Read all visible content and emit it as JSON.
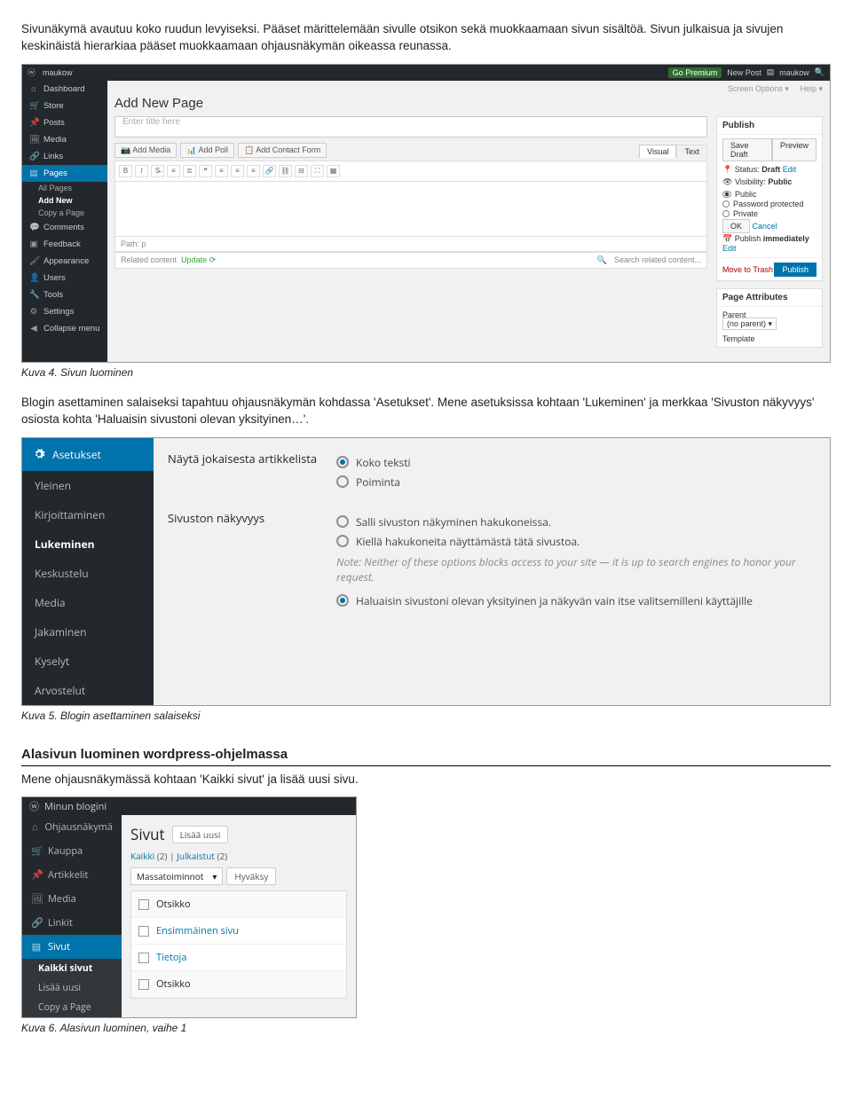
{
  "intro": {
    "p1": "Sivunäkymä avautuu koko ruudun levyiseksi. Pääset märittelemään sivulle otsikon sekä muokkaamaan sivun sisältöä. Sivun julkaisua ja sivujen keskinäistä hierarkiaa pääset muokkaamaan ohjausnäkymän oikeassa reunassa."
  },
  "s1": {
    "adminbar_site": "maukow",
    "adminbar_premium": "Go Premium",
    "adminbar_newpost": "New Post",
    "adminbar_user": "maukow",
    "screen_options": "Screen Options ▾",
    "help_tab": "Help ▾",
    "menu": [
      "Dashboard",
      "Store",
      "Posts",
      "Media",
      "Links",
      "Pages",
      "Comments",
      "Feedback",
      "Appearance",
      "Users",
      "Tools",
      "Settings",
      "Collapse menu"
    ],
    "pages_sub": [
      "All Pages",
      "Add New",
      "Copy a Page"
    ],
    "h1": "Add New Page",
    "placeholder": "Enter title here",
    "add_media": "Add Media",
    "add_poll": "Add Poll",
    "add_contact": "Add Contact Form",
    "visual": "Visual",
    "text": "Text",
    "path_label": "Path:",
    "path_val": "p",
    "related_label": "Related content",
    "update": "Update",
    "search_related": "Search related content...",
    "publish": {
      "title": "Publish",
      "save_draft": "Save Draft",
      "preview": "Preview",
      "status_lbl": "Status:",
      "status_val": "Draft",
      "edit": "Edit",
      "visibility_lbl": "Visibility:",
      "visibility_val": "Public",
      "v_public": "Public",
      "v_pw": "Password protected",
      "v_priv": "Private",
      "ok": "OK",
      "cancel": "Cancel",
      "sched_lbl": "Publish",
      "sched_val": "immediately",
      "trash": "Move to Trash",
      "publish_btn": "Publish"
    },
    "attrs": {
      "title": "Page Attributes",
      "parent_lbl": "Parent",
      "parent_val": "(no parent)",
      "template_lbl": "Template"
    }
  },
  "caption1": "Kuva 4. Sivun luominen",
  "mid": {
    "p1": "Blogin asettaminen salaiseksi tapahtuu ohjausnäkymän kohdassa 'Asetukset'. Mene asetuksissa kohtaan 'Lukeminen' ja merkkaa 'Sivuston näkyvyys' osiosta kohta 'Haluaisin sivustoni olevan yksityinen…'."
  },
  "s2": {
    "side_header": "Asetukset",
    "menu": [
      "Yleinen",
      "Kirjoittaminen",
      "Lukeminen",
      "Keskustelu",
      "Media",
      "Jakaminen",
      "Kyselyt",
      "Arvostelut"
    ],
    "row1_label": "Näytä jokaisesta artikkelista",
    "row1_opt1": "Koko teksti",
    "row1_opt2": "Poiminta",
    "row2_label": "Sivuston näkyvyys",
    "row2_opt1": "Salli sivuston näkyminen hakukoneissa.",
    "row2_opt2": "Kiellä hakukoneita näyttämästä tätä sivustoa.",
    "note": "Note: Neither of these options blocks access to your site — it is up to search engines to honor your request.",
    "row2_opt3": "Haluaisin sivustoni olevan yksityinen ja näkyvän vain itse valitsemilleni käyttäjille"
  },
  "caption2": "Kuva 5. Blogin asettaminen salaiseksi",
  "section2_title": "Alasivun luominen wordpress-ohjelmassa",
  "section2_body": "Mene ohjausnäkymässä kohtaan 'Kaikki sivut' ja lisää uusi sivu.",
  "s3": {
    "site": "Minun blogini",
    "menu": [
      "Ohjausnäkymä",
      "Kauppa",
      "Artikkelit",
      "Media",
      "Linkit",
      "Sivut"
    ],
    "subs": [
      "Kaikki sivut",
      "Lisää uusi",
      "Copy a Page"
    ],
    "h2": "Sivut",
    "add": "Lisää uusi",
    "filter_all": "Kaikki",
    "filter_all_n": "(2)",
    "filter_pub": "Julkaistut",
    "filter_pub_n": "(2)",
    "bulk": "Massatoiminnot",
    "apply": "Hyväksy",
    "col_title": "Otsikko",
    "rows": [
      "Ensimmäinen sivu",
      "Tietoja"
    ],
    "footer_col": "Otsikko"
  },
  "caption3": "Kuva 6. Alasivun luominen, vaihe 1"
}
